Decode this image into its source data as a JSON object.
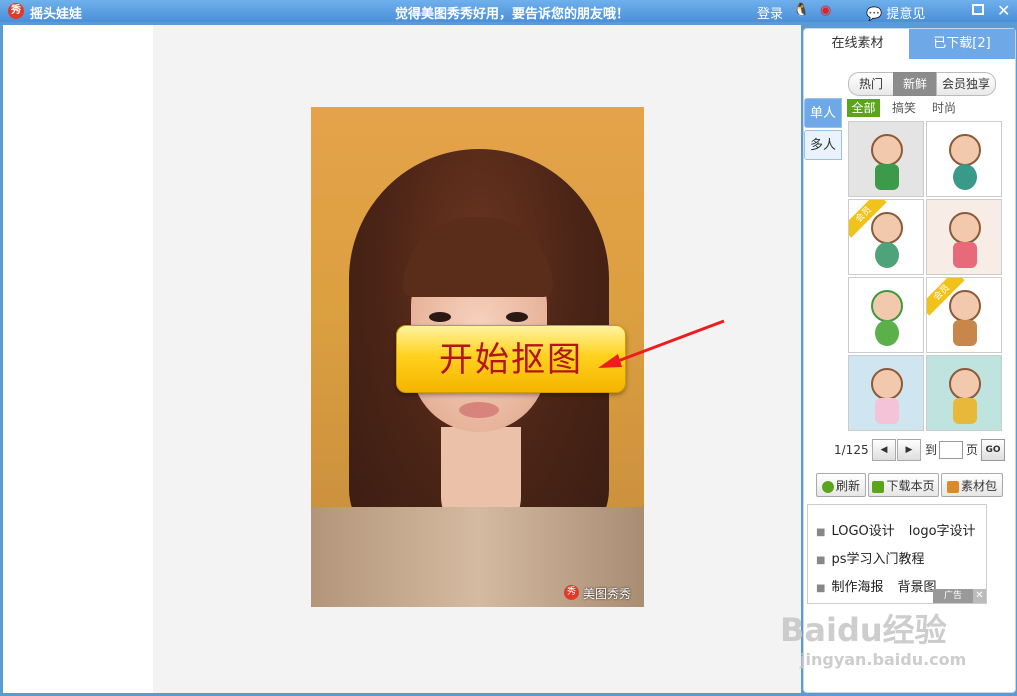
{
  "titlebar": {
    "app_name": "摇头娃娃",
    "logo_char": "秀",
    "slogan": "觉得美图秀秀好用，要告诉您的朋友哦！",
    "login": "登录",
    "feedback": "提意见"
  },
  "canvas": {
    "start_button": "开始抠图",
    "watermark_icon": "秀",
    "watermark_text": "美图秀秀"
  },
  "panel": {
    "tabs": [
      "在线素材",
      "已下载[2]"
    ],
    "filters": [
      "热门",
      "新鲜",
      "会员独享"
    ],
    "subfilters": [
      "全部",
      "搞笑",
      "时尚"
    ],
    "side_tabs": [
      "单人",
      "多人"
    ],
    "vip_badge": "会员",
    "pager": {
      "count": "1/125",
      "to": "到",
      "page": "页",
      "go": "GO"
    },
    "buttons": {
      "refresh": "刷新",
      "download_page": "下载本页",
      "package": "素材包"
    },
    "ad_links": [
      "LOGO设计",
      "logo字设计",
      "ps学习入门教程",
      "制作海报",
      "背景图"
    ],
    "ad_label": "广告"
  },
  "watermark": {
    "main": "Baidu经验",
    "sub": "jingyan.baidu.com"
  }
}
